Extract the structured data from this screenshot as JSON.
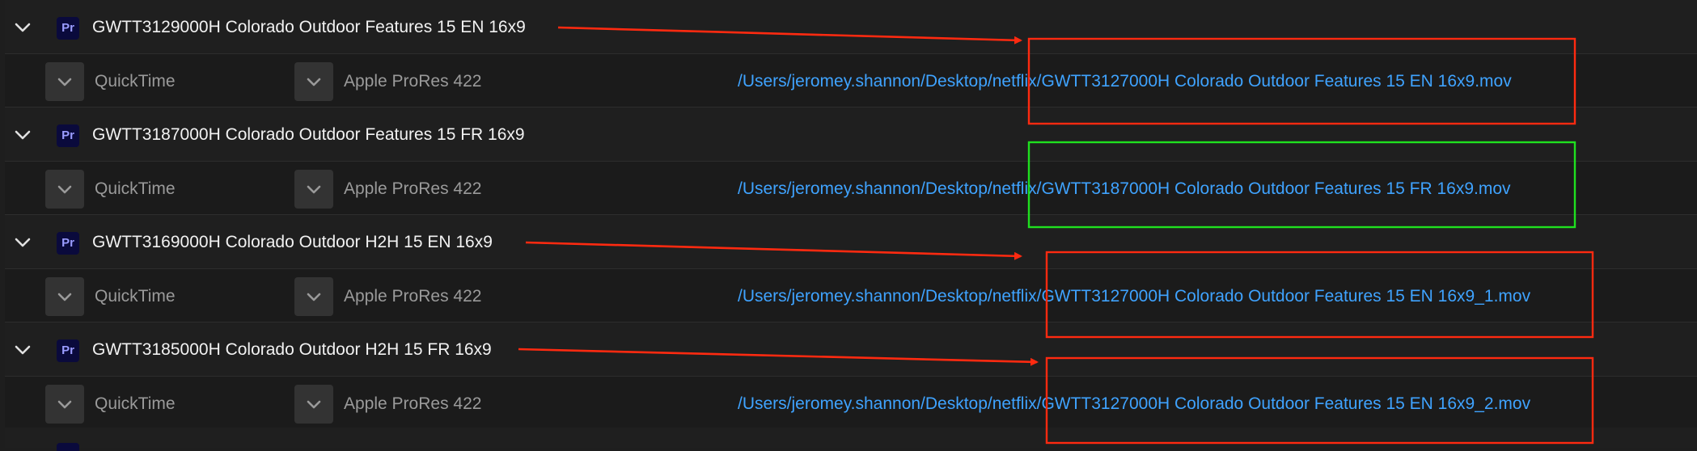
{
  "queue": {
    "items": [
      {
        "badge": "Pr",
        "title": "GWTT3129000H Colorado Outdoor Features 15 EN 16x9",
        "format": "QuickTime",
        "preset": "Apple ProRes 422",
        "output": "/Users/jeromey.shannon/Desktop/netflix/GWTT3127000H Colorado Outdoor Features 15 EN 16x9.mov"
      },
      {
        "badge": "Pr",
        "title": "GWTT3187000H Colorado Outdoor Features 15 FR 16x9",
        "format": "QuickTime",
        "preset": "Apple ProRes 422",
        "output": "/Users/jeromey.shannon/Desktop/netflix/GWTT3187000H Colorado Outdoor Features 15 FR 16x9.mov"
      },
      {
        "badge": "Pr",
        "title": "GWTT3169000H Colorado Outdoor H2H 15 EN 16x9",
        "format": "QuickTime",
        "preset": "Apple ProRes 422",
        "output": "/Users/jeromey.shannon/Desktop/netflix/GWTT3127000H Colorado Outdoor Features 15 EN 16x9_1.mov"
      },
      {
        "badge": "Pr",
        "title": "GWTT3185000H Colorado Outdoor H2H 15 FR 16x9",
        "format": "QuickTime",
        "preset": "Apple ProRes 422",
        "output": "/Users/jeromey.shannon/Desktop/netflix/GWTT3127000H Colorado Outdoor Features 15 EN 16x9_2.mov"
      }
    ]
  },
  "annotations": {
    "error_color": "#ff2a10",
    "ok_color": "#1fe01f"
  },
  "icons": {
    "expand": "chevron-down-icon",
    "dropdown": "chevron-down-icon",
    "app_badge": "premiere-pro-icon"
  }
}
